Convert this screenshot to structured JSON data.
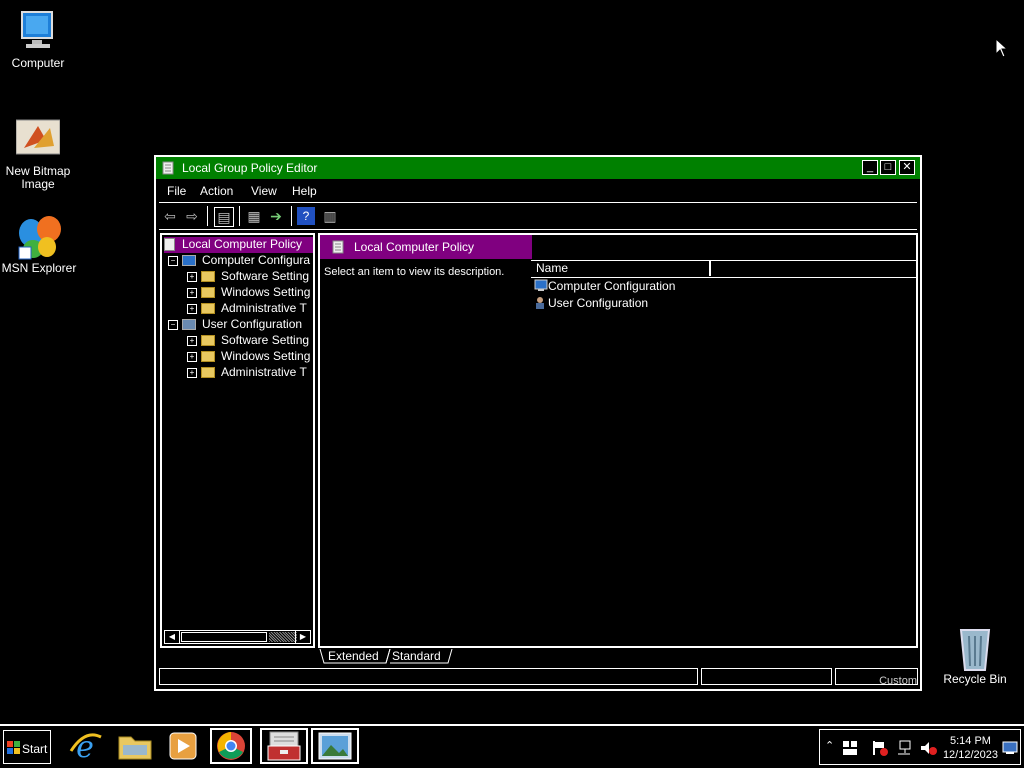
{
  "desktop": {
    "icons": [
      {
        "label": "Computer"
      },
      {
        "label": "New Bitmap Image"
      },
      {
        "label": "MSN Explorer"
      },
      {
        "label": "Recycle Bin"
      }
    ]
  },
  "window": {
    "title": "Local Group Policy Editor",
    "controls": {
      "minimize": "_",
      "maximize": "□",
      "close": "✕"
    },
    "menu": [
      "File",
      "Action",
      "View",
      "Help"
    ],
    "tree": [
      {
        "label": "Local Computer Policy"
      },
      {
        "label": "Computer Configura"
      },
      {
        "label": "Software Setting"
      },
      {
        "label": "Windows Setting"
      },
      {
        "label": "Administrative T"
      },
      {
        "label": "User Configuration"
      },
      {
        "label": "Software Setting"
      },
      {
        "label": "Windows Setting"
      },
      {
        "label": "Administrative T"
      }
    ],
    "right": {
      "header": "Local Computer Policy",
      "description": "Select an item to view its description.",
      "columns": [
        "Name",
        ""
      ],
      "items": [
        "Computer Configuration",
        "User Configuration"
      ]
    },
    "tabs": [
      "Extended",
      "Standard"
    ],
    "status": [
      "",
      "",
      "Custom"
    ]
  },
  "taskbar": {
    "start_label": "Start",
    "clock_time": "5:14 PM",
    "clock_date": "12/12/2023"
  },
  "colors": {
    "title_bar": "#008000",
    "selection": "#800080",
    "background": "#000000",
    "foreground": "#ffffff"
  }
}
